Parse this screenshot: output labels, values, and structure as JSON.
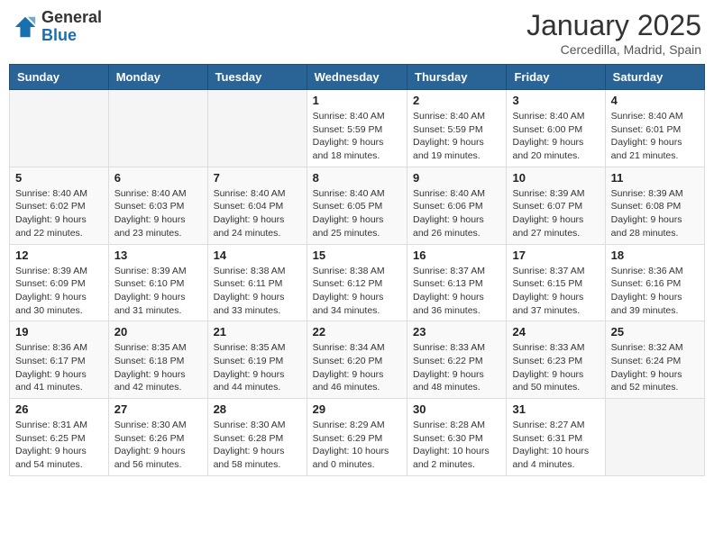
{
  "header": {
    "logo_general": "General",
    "logo_blue": "Blue",
    "month_title": "January 2025",
    "location": "Cercedilla, Madrid, Spain"
  },
  "weekdays": [
    "Sunday",
    "Monday",
    "Tuesday",
    "Wednesday",
    "Thursday",
    "Friday",
    "Saturday"
  ],
  "weeks": [
    [
      {
        "day": "",
        "info": ""
      },
      {
        "day": "",
        "info": ""
      },
      {
        "day": "",
        "info": ""
      },
      {
        "day": "1",
        "info": "Sunrise: 8:40 AM\nSunset: 5:59 PM\nDaylight: 9 hours\nand 18 minutes."
      },
      {
        "day": "2",
        "info": "Sunrise: 8:40 AM\nSunset: 5:59 PM\nDaylight: 9 hours\nand 19 minutes."
      },
      {
        "day": "3",
        "info": "Sunrise: 8:40 AM\nSunset: 6:00 PM\nDaylight: 9 hours\nand 20 minutes."
      },
      {
        "day": "4",
        "info": "Sunrise: 8:40 AM\nSunset: 6:01 PM\nDaylight: 9 hours\nand 21 minutes."
      }
    ],
    [
      {
        "day": "5",
        "info": "Sunrise: 8:40 AM\nSunset: 6:02 PM\nDaylight: 9 hours\nand 22 minutes."
      },
      {
        "day": "6",
        "info": "Sunrise: 8:40 AM\nSunset: 6:03 PM\nDaylight: 9 hours\nand 23 minutes."
      },
      {
        "day": "7",
        "info": "Sunrise: 8:40 AM\nSunset: 6:04 PM\nDaylight: 9 hours\nand 24 minutes."
      },
      {
        "day": "8",
        "info": "Sunrise: 8:40 AM\nSunset: 6:05 PM\nDaylight: 9 hours\nand 25 minutes."
      },
      {
        "day": "9",
        "info": "Sunrise: 8:40 AM\nSunset: 6:06 PM\nDaylight: 9 hours\nand 26 minutes."
      },
      {
        "day": "10",
        "info": "Sunrise: 8:39 AM\nSunset: 6:07 PM\nDaylight: 9 hours\nand 27 minutes."
      },
      {
        "day": "11",
        "info": "Sunrise: 8:39 AM\nSunset: 6:08 PM\nDaylight: 9 hours\nand 28 minutes."
      }
    ],
    [
      {
        "day": "12",
        "info": "Sunrise: 8:39 AM\nSunset: 6:09 PM\nDaylight: 9 hours\nand 30 minutes."
      },
      {
        "day": "13",
        "info": "Sunrise: 8:39 AM\nSunset: 6:10 PM\nDaylight: 9 hours\nand 31 minutes."
      },
      {
        "day": "14",
        "info": "Sunrise: 8:38 AM\nSunset: 6:11 PM\nDaylight: 9 hours\nand 33 minutes."
      },
      {
        "day": "15",
        "info": "Sunrise: 8:38 AM\nSunset: 6:12 PM\nDaylight: 9 hours\nand 34 minutes."
      },
      {
        "day": "16",
        "info": "Sunrise: 8:37 AM\nSunset: 6:13 PM\nDaylight: 9 hours\nand 36 minutes."
      },
      {
        "day": "17",
        "info": "Sunrise: 8:37 AM\nSunset: 6:15 PM\nDaylight: 9 hours\nand 37 minutes."
      },
      {
        "day": "18",
        "info": "Sunrise: 8:36 AM\nSunset: 6:16 PM\nDaylight: 9 hours\nand 39 minutes."
      }
    ],
    [
      {
        "day": "19",
        "info": "Sunrise: 8:36 AM\nSunset: 6:17 PM\nDaylight: 9 hours\nand 41 minutes."
      },
      {
        "day": "20",
        "info": "Sunrise: 8:35 AM\nSunset: 6:18 PM\nDaylight: 9 hours\nand 42 minutes."
      },
      {
        "day": "21",
        "info": "Sunrise: 8:35 AM\nSunset: 6:19 PM\nDaylight: 9 hours\nand 44 minutes."
      },
      {
        "day": "22",
        "info": "Sunrise: 8:34 AM\nSunset: 6:20 PM\nDaylight: 9 hours\nand 46 minutes."
      },
      {
        "day": "23",
        "info": "Sunrise: 8:33 AM\nSunset: 6:22 PM\nDaylight: 9 hours\nand 48 minutes."
      },
      {
        "day": "24",
        "info": "Sunrise: 8:33 AM\nSunset: 6:23 PM\nDaylight: 9 hours\nand 50 minutes."
      },
      {
        "day": "25",
        "info": "Sunrise: 8:32 AM\nSunset: 6:24 PM\nDaylight: 9 hours\nand 52 minutes."
      }
    ],
    [
      {
        "day": "26",
        "info": "Sunrise: 8:31 AM\nSunset: 6:25 PM\nDaylight: 9 hours\nand 54 minutes."
      },
      {
        "day": "27",
        "info": "Sunrise: 8:30 AM\nSunset: 6:26 PM\nDaylight: 9 hours\nand 56 minutes."
      },
      {
        "day": "28",
        "info": "Sunrise: 8:30 AM\nSunset: 6:28 PM\nDaylight: 9 hours\nand 58 minutes."
      },
      {
        "day": "29",
        "info": "Sunrise: 8:29 AM\nSunset: 6:29 PM\nDaylight: 10 hours\nand 0 minutes."
      },
      {
        "day": "30",
        "info": "Sunrise: 8:28 AM\nSunset: 6:30 PM\nDaylight: 10 hours\nand 2 minutes."
      },
      {
        "day": "31",
        "info": "Sunrise: 8:27 AM\nSunset: 6:31 PM\nDaylight: 10 hours\nand 4 minutes."
      },
      {
        "day": "",
        "info": ""
      }
    ]
  ]
}
